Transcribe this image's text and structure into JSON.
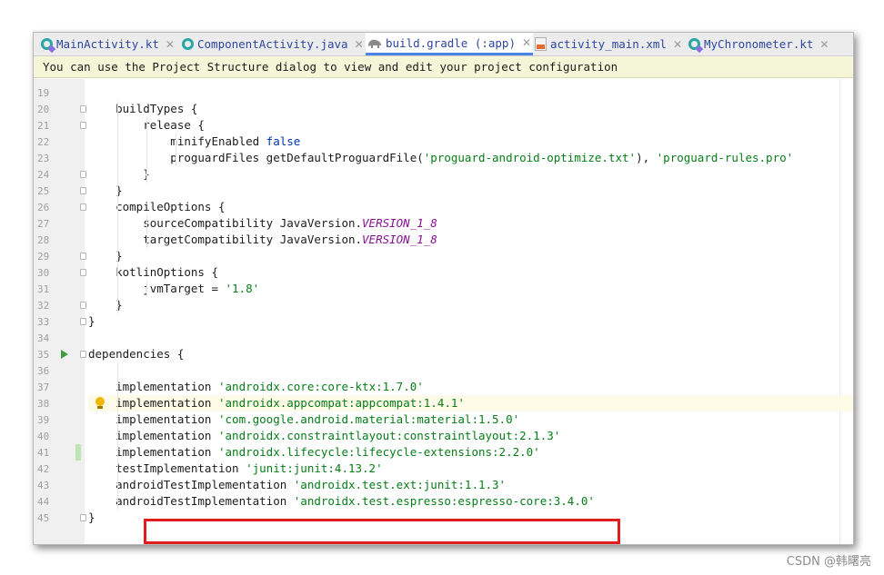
{
  "tabs": [
    {
      "label": "MainActivity.kt",
      "icon": "kotlin-class-icon",
      "active": false
    },
    {
      "label": "ComponentActivity.java",
      "icon": "java-class-icon",
      "active": false
    },
    {
      "label": "build.gradle (:app)",
      "icon": "gradle-elephant-icon",
      "active": true
    },
    {
      "label": "activity_main.xml",
      "icon": "xml-layout-icon",
      "active": false
    },
    {
      "label": "MyChronometer.kt",
      "icon": "kotlin-class-icon",
      "active": false
    }
  ],
  "banner": {
    "text": "You can use the Project Structure dialog to view and edit your project configuration"
  },
  "code": {
    "lines": [
      {
        "n": "19",
        "t": ""
      },
      {
        "n": "20",
        "t": "    buildTypes {"
      },
      {
        "n": "21",
        "t": "        release {"
      },
      {
        "n": "22",
        "a": "            minifyEnabled ",
        "b": "false"
      },
      {
        "n": "23",
        "a": "            proguardFiles getDefaultProguardFile(",
        "s1": "'proguard-android-optimize.txt'",
        "c": "), ",
        "s2": "'proguard-rules.pro'"
      },
      {
        "n": "24",
        "t": "        }"
      },
      {
        "n": "25",
        "t": "    }"
      },
      {
        "n": "26",
        "t": "    compileOptions {"
      },
      {
        "n": "27",
        "a": "        sourceCompatibility JavaVersion.",
        "k": "VERSION_1_8"
      },
      {
        "n": "28",
        "a": "        targetCompatibility JavaVersion.",
        "k": "VERSION_1_8"
      },
      {
        "n": "29",
        "t": "    }"
      },
      {
        "n": "30",
        "t": "    kotlinOptions {"
      },
      {
        "n": "31",
        "a": "        jvmTarget = ",
        "s1": "'1.8'"
      },
      {
        "n": "32",
        "t": "    }"
      },
      {
        "n": "33",
        "t": "}"
      },
      {
        "n": "34",
        "t": ""
      },
      {
        "n": "35",
        "t": "dependencies {"
      },
      {
        "n": "36",
        "t": ""
      },
      {
        "n": "37",
        "a": "    implementation ",
        "s1": "'androidx.core:core-ktx:1.7.0'"
      },
      {
        "n": "38",
        "a": "    implementation ",
        "s1": "'androidx.appcompat:appcompat:1.4.1'"
      },
      {
        "n": "39",
        "a": "    implementation ",
        "s1": "'com.google.android.material:material:1.5.0'"
      },
      {
        "n": "40",
        "a": "    implementation ",
        "s1": "'androidx.constraintlayout:constraintlayout:2.1.3'"
      },
      {
        "n": "41",
        "a": "    implementation ",
        "s1": "'androidx.lifecycle:lifecycle-extensions:2.2.0'"
      },
      {
        "n": "42",
        "a": "    testImplementation ",
        "s1": "'junit:junit:4.13.2'"
      },
      {
        "n": "43",
        "a": "    androidTestImplementation ",
        "s1": "'androidx.test.ext:junit:1.1.3'"
      },
      {
        "n": "44",
        "a": "    androidTestImplementation ",
        "s1": "'androidx.test.espresso:espresso-core:3.4.0'"
      },
      {
        "n": "45",
        "t": "}"
      }
    ]
  },
  "watermark": "CSDN @韩曙亮",
  "colors": {
    "string": "#067d17",
    "keyword": "#0033b3",
    "constant": "#871094",
    "highlight_box": "#e11d1d"
  }
}
